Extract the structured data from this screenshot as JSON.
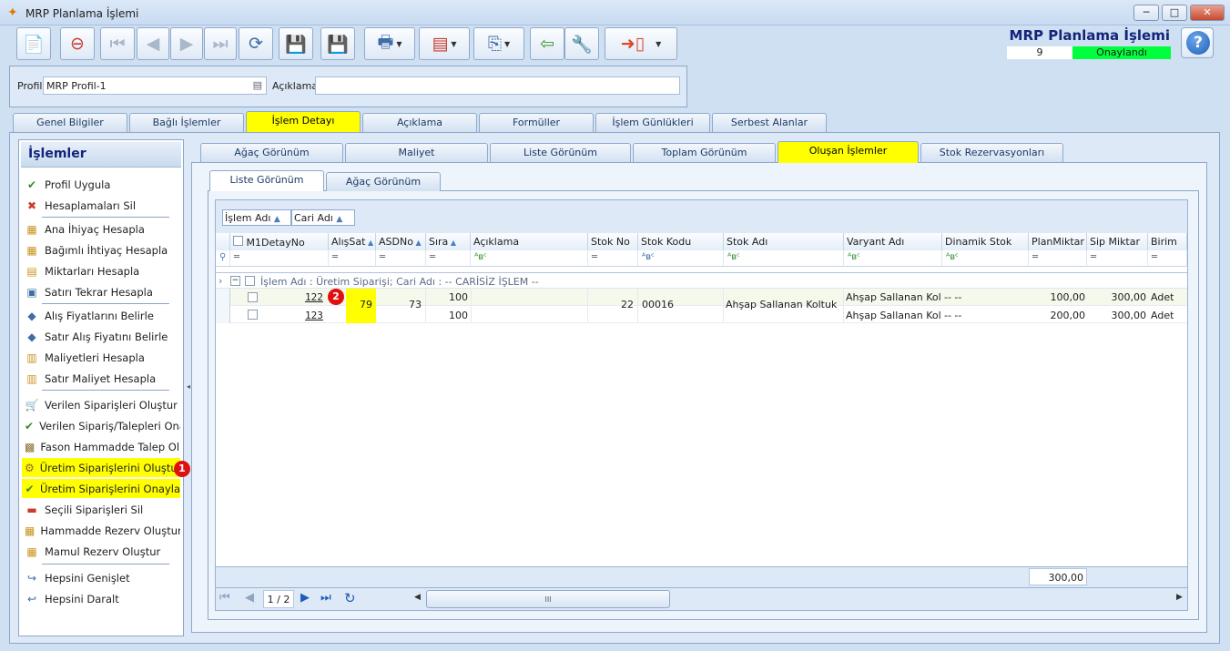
{
  "window": {
    "title": "MRP Planlama İşlemi",
    "min": "─",
    "max": "□",
    "close": "✕"
  },
  "header": {
    "title": "MRP Planlama İşlemi",
    "record_no": "9",
    "status": "Onaylandı",
    "help": "?"
  },
  "toolbar": {
    "icons": [
      "new-doc-icon",
      "delete-doc-icon",
      "first-record-icon",
      "prev-record-icon",
      "next-record-icon",
      "last-record-icon",
      "refresh-icon",
      "save-icon",
      "save-close-icon",
      "print-icon",
      "pdf-icon",
      "export-icon",
      "import-icon",
      "settings-icon",
      "exit-icon"
    ]
  },
  "profile": {
    "label": "Profil",
    "value": "MRP Profil-1",
    "desc_label": "Açıklama",
    "desc_value": ""
  },
  "main_tabs": [
    "Genel Bilgiler",
    "Bağlı İşlemler",
    "İşlem Detayı",
    "Açıklama",
    "Formüller",
    "İşlem Günlükleri",
    "Serbest Alanlar"
  ],
  "sub_tabs": [
    "Ağaç Görünüm",
    "Maliyet",
    "Liste Görünüm",
    "Toplam Görünüm",
    "Oluşan İşlemler",
    "Stok Rezervasyonları"
  ],
  "view_tabs": [
    "Liste Görünüm",
    "Ağaç Görünüm"
  ],
  "left": {
    "title": "İşlemler",
    "items": [
      "Profil Uygula",
      "Hesaplamaları Sil",
      "Ana İhiyaç Hesapla",
      "Bağımlı İhtiyaç Hesapla",
      "Miktarları Hesapla",
      "Satırı Tekrar Hesapla",
      "Alış Fiyatlarını Belirle",
      "Satır Alış Fiyatını Belirle",
      "Maliyetleri Hesapla",
      "Satır Maliyet Hesapla",
      "Verilen Siparişleri Oluştur",
      "Verilen Sipariş/Talepleri Ona...",
      "Fason Hammadde Talep Ol...",
      "Üretim Siparişlerini Oluştur",
      "Üretim Siparişlerini Onayla",
      "Seçili Siparişleri Sil",
      "Hammadde Rezerv Oluştur",
      "Mamul Rezerv Oluştur",
      "Hepsini Genişlet",
      "Hepsini Daralt"
    ]
  },
  "badges": [
    "1",
    "2"
  ],
  "grid": {
    "group_by": [
      "İşlem Adı",
      "Cari Adı"
    ],
    "columns": [
      "M1DetayNo",
      "AlışSat",
      "ASDNo",
      "Sıra",
      "Açıklama",
      "Stok No",
      "Stok Kodu",
      "Stok Adı",
      "Varyant Adı",
      "Dinamik Stok",
      "PlanMiktar",
      "Sip Miktar",
      "Birim"
    ],
    "group_row": "İşlem Adı : Üretim Siparişi;  Cari Adı : -- CARİSİZ İŞLEM --",
    "rows": [
      {
        "m1": "122",
        "alis": "79",
        "asd": "73",
        "sira": "100",
        "stokno": "22",
        "stokkodu": "00016",
        "stokadi": "Ahşap Sallanan Koltuk",
        "varyant": "Ahşap Sallanan Koltuk",
        "dinamik": "-- --",
        "plan": "100,00",
        "sip": "300,00",
        "birim": "Adet"
      },
      {
        "m1": "123",
        "sira": "100",
        "varyant": "Ahşap Sallanan Koltuk",
        "dinamik": "-- --",
        "plan": "200,00",
        "sip": "300,00",
        "birim": "Adet"
      }
    ],
    "footer_total": "300,00",
    "pager": "1 / 2",
    "scroll_thumb": "III"
  },
  "colors": {
    "highlight": "#ffff00",
    "status_green": "#00ff3c",
    "badge_red": "#e01010"
  }
}
